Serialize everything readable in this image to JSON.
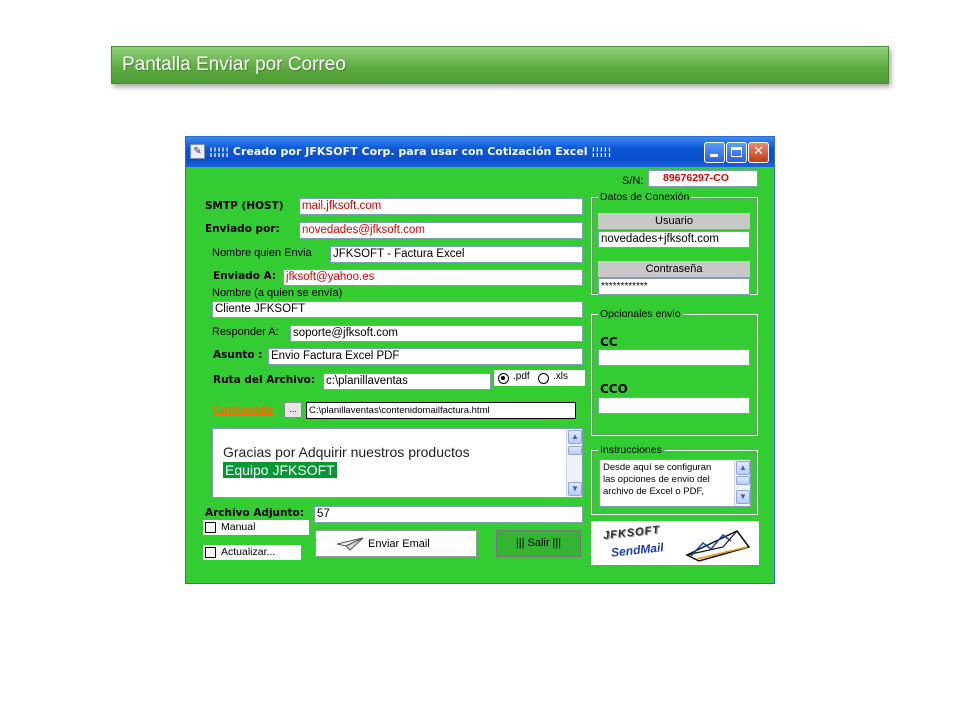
{
  "slide": {
    "title": "Pantalla Enviar por Correo"
  },
  "window": {
    "title": "¦¦¦¦¦ Creado por JFKSOFT Corp.  para usar con Cotización Excel  ¦¦¦¦¦",
    "titlebar_color": "#0a56d8",
    "body_color": "#33cc33"
  },
  "serial": {
    "label": "S/N:",
    "value": "89676297-CO"
  },
  "form": {
    "smtp_label": "SMTP (HOST)",
    "smtp_value": "mail.jfksoft.com",
    "enviado_por_label": "Enviado por:",
    "enviado_por_value": "novedades@jfksoft.com",
    "nombre_envia_label": "Nombre quien Envia",
    "nombre_envia_value": "JFKSOFT - Factura Excel",
    "enviado_a_label": "Enviado A:",
    "enviado_a_value": "jfksoft@yahoo.es",
    "nombre_destino_label": "Nombre (a quien se envía)",
    "nombre_destino_value": "Cliente JFKSOFT",
    "responder_label": "Responder A:",
    "responder_value": "soporte@jfksoft.com",
    "asunto_label": "Asunto :",
    "asunto_value": "Envio Factura Excel PDF",
    "ruta_label": "Ruta del Archivo:",
    "ruta_value": "c:\\planillaventas",
    "format_pdf": ".pdf",
    "format_xls": ".xls",
    "contenido_link": "Contenido",
    "contenido_browse": "...",
    "contenido_path": "C:\\planillaventas\\contenidomailfactura.html",
    "message_line1": "Gracias por Adquirir  nuestros productos",
    "message_line2": "Equipo JFKSOFT",
    "adjunto_label": "Archivo Adjunto:",
    "adjunto_value": "57",
    "manual_label": "Manual",
    "actualizar_label": "Actualizar..."
  },
  "conexion": {
    "title": "Datos de Conexión",
    "usuario_label": "Usuario",
    "usuario_value": "novedades+jfksoft.com",
    "contrasena_label": "Contraseña",
    "contrasena_value": "************"
  },
  "opcionales": {
    "title": "Opcionales envio",
    "cc_label": "CC",
    "cc_value": "",
    "cco_label": "CCO",
    "cco_value": ""
  },
  "instrucciones": {
    "title": "Instrucciones",
    "text_line1": "Desde aquí se configuran",
    "text_line2": "las opciones de envio del",
    "text_line3": "archivo de Excel o PDF,"
  },
  "buttons": {
    "enviar": "Enviar Email",
    "salir": "||| Salir |||"
  },
  "logo": {
    "text_top": "JFKSOFT",
    "text_bottom": "SendMail"
  },
  "icons": {
    "app": "mail-app-icon",
    "envelope": "envelope-icon",
    "plane": "paper-plane-icon"
  }
}
